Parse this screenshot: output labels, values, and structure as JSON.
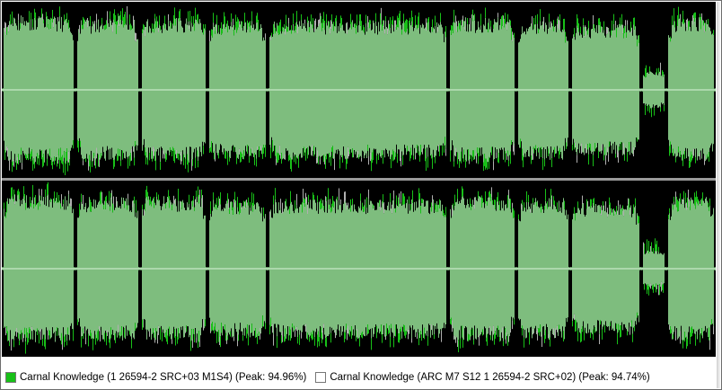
{
  "colors": {
    "background": "#000000",
    "series_a": "#18c018",
    "series_b": "#ffffff",
    "overlap": "#7ebd7e",
    "center_line": "#c8e8c8"
  },
  "legend": {
    "items": [
      {
        "label": "Carnal Knowledge (1 26594-2 SRC+03 M1S4) (Peak: 94.96%)",
        "color": "#18c018"
      },
      {
        "label": "Carnal Knowledge (ARC M7 S12 1 26594-2 SRC+02) (Peak: 94.74%)",
        "color": "#ffffff"
      }
    ]
  },
  "waveform": {
    "channels": 2,
    "segments": [
      {
        "start": 0.0,
        "end": 0.103,
        "level": 0.88
      },
      {
        "start": 0.103,
        "end": 0.193,
        "level": 0.85
      },
      {
        "start": 0.193,
        "end": 0.287,
        "level": 0.86
      },
      {
        "start": 0.287,
        "end": 0.372,
        "level": 0.82
      },
      {
        "start": 0.372,
        "end": 0.625,
        "level": 0.83
      },
      {
        "start": 0.625,
        "end": 0.72,
        "level": 0.86
      },
      {
        "start": 0.72,
        "end": 0.795,
        "level": 0.84
      },
      {
        "start": 0.795,
        "end": 0.895,
        "level": 0.78
      },
      {
        "start": 0.895,
        "end": 0.93,
        "level": 0.22
      },
      {
        "start": 0.93,
        "end": 1.0,
        "level": 0.86
      }
    ]
  }
}
